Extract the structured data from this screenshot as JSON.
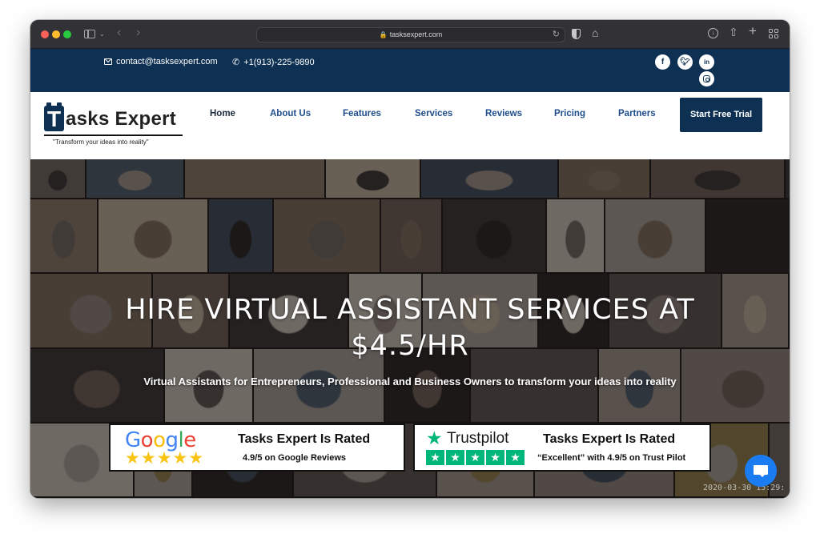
{
  "browser": {
    "url": "tasksexpert.com",
    "icons": [
      "sidebar-icon",
      "chevron-down-icon",
      "back-icon",
      "forward-icon",
      "lock-icon",
      "reload-icon",
      "shield-icon",
      "home-icon",
      "download-icon",
      "share-icon",
      "new-tab-icon",
      "tab-overview-icon"
    ]
  },
  "topbar": {
    "email": "contact@tasksexpert.com",
    "phone": "+1(913)-225-9890",
    "social": [
      {
        "name": "facebook",
        "glyph": "f"
      },
      {
        "name": "twitter",
        "glyph": "t"
      },
      {
        "name": "linkedin",
        "glyph": "in"
      },
      {
        "name": "instagram",
        "glyph": ""
      }
    ]
  },
  "header": {
    "logo_letter": "T",
    "logo_text": "asks Expert",
    "tagline": "\"Transform your ideas into reality\"",
    "nav": [
      {
        "label": "Home",
        "active": true
      },
      {
        "label": "About Us"
      },
      {
        "label": "Features"
      },
      {
        "label": "Services"
      },
      {
        "label": "Reviews"
      },
      {
        "label": "Pricing"
      },
      {
        "label": "Partners"
      }
    ],
    "cta_label": "Start Free Trial"
  },
  "hero": {
    "headline_line1": "HIRE VIRTUAL ASSISTANT SERVICES AT",
    "headline_line2": "$4.5/HR",
    "subline": "Virtual Assistants for Entrepreneurs, Professional and Business Owners to transform your ideas into reality",
    "timestamp": "2020-03-30  15:29:",
    "badges": {
      "google": {
        "brand": "Google",
        "stars": "★★★★★",
        "title": "Tasks Expert Is Rated",
        "subtitle": "4.9/5 on Google Reviews",
        "rating": 4.9,
        "out_of": 5
      },
      "trustpilot": {
        "brand": "Trustpilot",
        "stars": 5,
        "title": "Tasks Expert Is Rated",
        "subtitle": "“Excellent” with 4.9/5 on Trust Pilot",
        "rating": 4.9,
        "out_of": 5
      }
    }
  },
  "colors": {
    "navy": "#0e3052",
    "nav_link": "#1e4d8c",
    "trustpilot_green": "#00b67a",
    "google_star": "#f8c517",
    "chat_blue": "#1b7cf2"
  }
}
